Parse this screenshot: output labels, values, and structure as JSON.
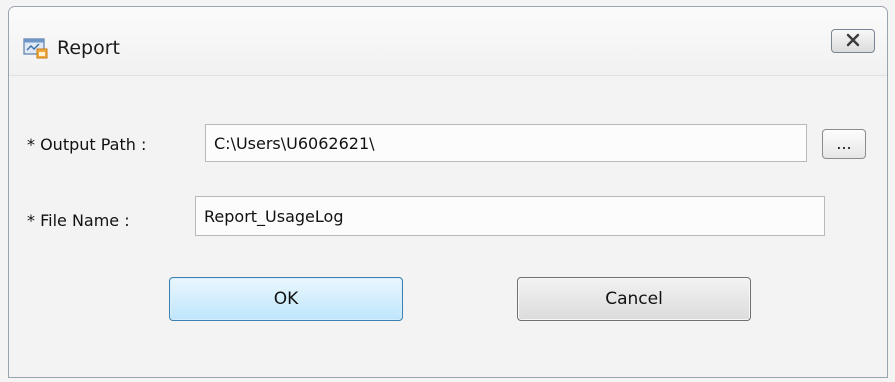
{
  "window": {
    "title": "Report"
  },
  "form": {
    "output_path_label": "* Output Path :",
    "output_path_value": "C:\\Users\\U6062621\\",
    "browse_label": "...",
    "file_name_label": "* File Name :",
    "file_name_value": "Report_UsageLog"
  },
  "buttons": {
    "ok_label": "OK",
    "cancel_label": "Cancel"
  },
  "icons": {
    "title": "report-window-icon",
    "close": "close-icon"
  },
  "colors": {
    "ok_button_border": "#3c7fb1",
    "ok_button_fill": "#bee6fd",
    "window_background": "#f3f3f3"
  }
}
